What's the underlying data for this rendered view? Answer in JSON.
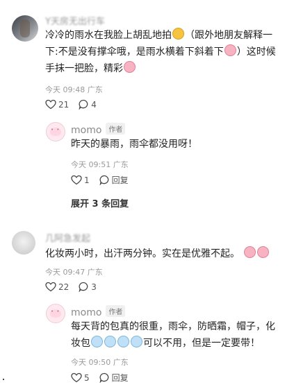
{
  "comments": [
    {
      "username": "Y天房无出行车",
      "text_lines": [
        "冷冷的雨水在我脸上胡乱地拍",
        "（跟外地朋友解释一",
        "下:不是没有撑伞哦，是雨水横着下斜着下",
        "）这时候",
        "手抹一把脸，精彩"
      ],
      "time": "今天 09:48 广东",
      "likes": "21",
      "replies": "4",
      "reply": {
        "username": "momo",
        "author_tag": "作者",
        "text": "昨天的暴雨，雨伞都没用呀！",
        "time": "今天 09:51 广东",
        "likes": "1",
        "reply_label": "回复"
      },
      "expand_label": "展开 3 条回复"
    },
    {
      "username": "几阿急发起",
      "text": "化妆两小时，出汗两分钟。实在是优雅不起。",
      "time": "今天 09:47 广东",
      "likes": "22",
      "replies": "3",
      "reply": {
        "username": "momo",
        "author_tag": "作者",
        "text_lines": [
          "每天背的包真的很重，雨伞，防晒霜，帽子，化",
          "妆包",
          "可以不用，但是一定要带！"
        ],
        "time": "今天 09:50 广东",
        "likes": "5",
        "reply_label": "回复"
      }
    }
  ],
  "icons": [
    "like-icon",
    "comment-icon",
    "emoji-sunglasses-icon",
    "emoji-pig-icon",
    "emoji-cry-icon"
  ]
}
